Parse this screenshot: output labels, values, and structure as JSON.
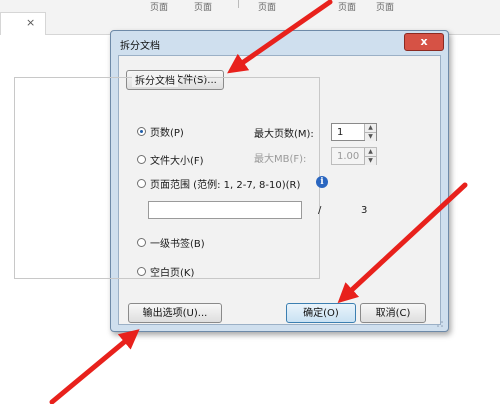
{
  "background": {
    "tab_close": "×",
    "menu_items": [
      "页面",
      "页面",
      "页面",
      "页面",
      "页面"
    ]
  },
  "dialog": {
    "title": "拆分文档",
    "close_glyph": "x",
    "select_more_files_button": "选择更多文件(S)...",
    "group_title": "拆分文档",
    "options": {
      "by_pages": "页数(P)",
      "by_file_size": "文件大小(F)",
      "by_page_range": "页面范围 (范例: 1, 2-7, 8-10)(R)",
      "by_first_level_bookmark": "一级书签(B)",
      "by_blank_page": "空白页(K)"
    },
    "selected_option": "by_pages",
    "max_pages_label": "最大页数(M):",
    "max_pages_value": "1",
    "max_mb_label": "最大MB(F):",
    "max_mb_value": "1.00",
    "page_range_value": "",
    "page_range_separator": "/",
    "total_pages": "3",
    "info_glyph": "i",
    "output_options_button": "输出选项(U)...",
    "ok_button": "确定(O)",
    "cancel_button": "取消(C)"
  },
  "colors": {
    "arrow": "#e8211c",
    "dialog_frame": "#cfdfee",
    "close_button": "#d65245",
    "radio_selected": "#1f5da8",
    "info_icon": "#2a66c0"
  },
  "icons": {
    "close": "close-icon",
    "info": "info-icon",
    "spin_up": "spin-up-icon",
    "spin_down": "spin-down-icon"
  }
}
